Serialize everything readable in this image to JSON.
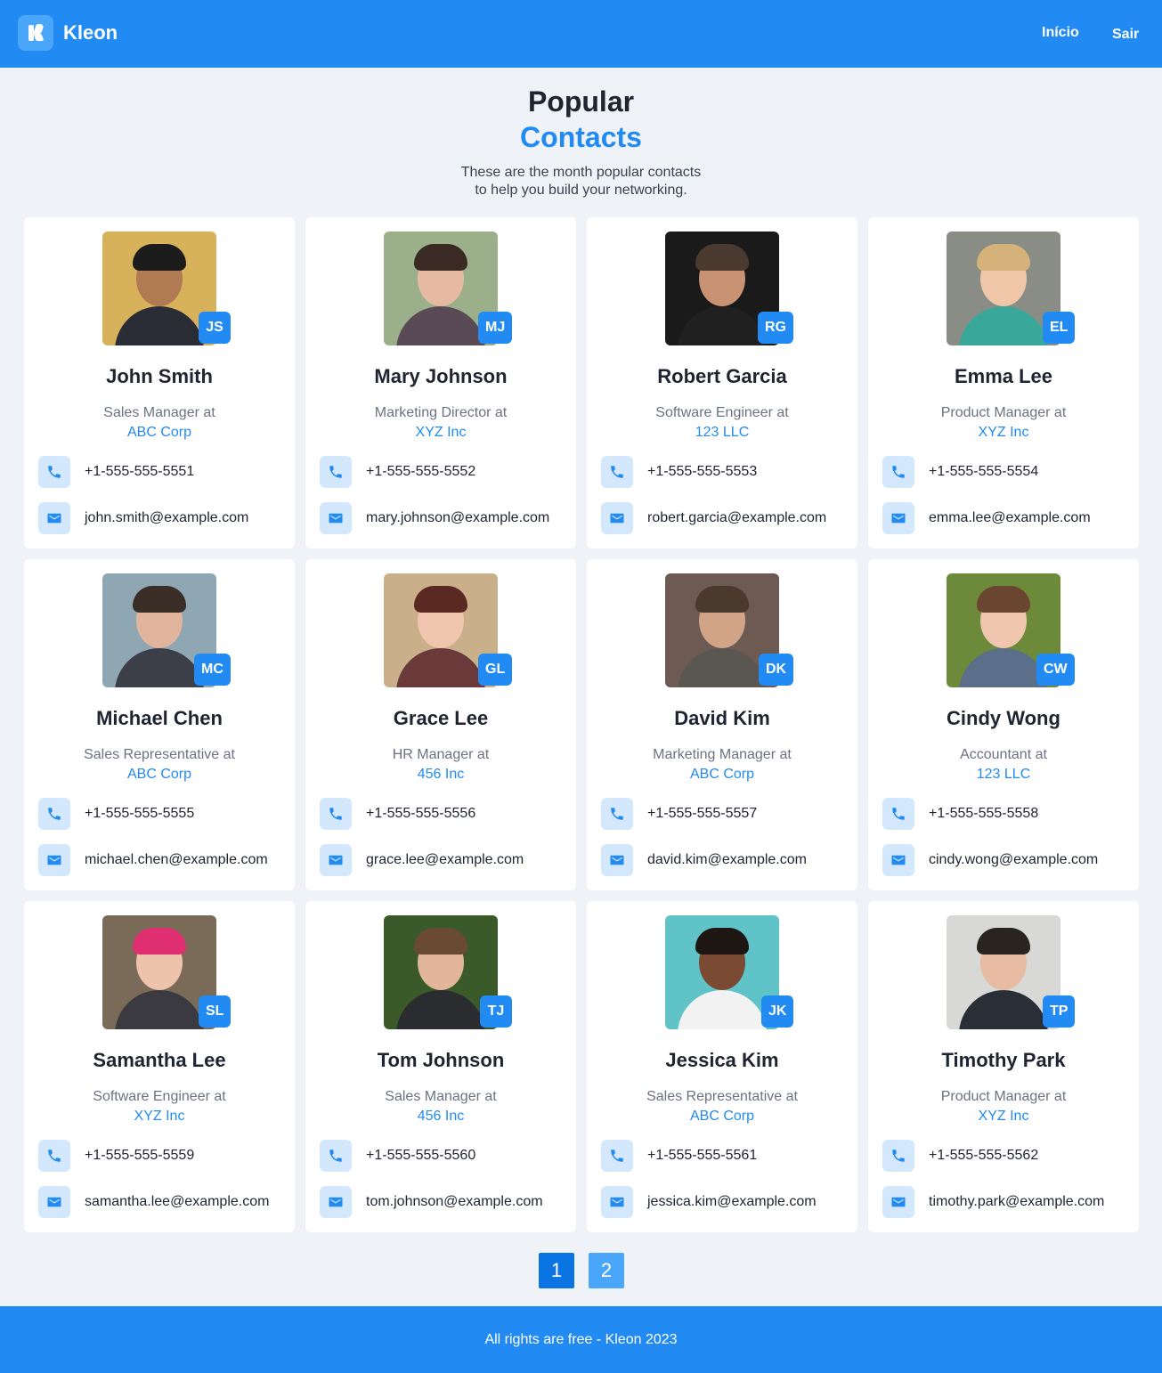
{
  "header": {
    "logo_text": "Kleon",
    "nav": [
      "Início",
      "Sair"
    ]
  },
  "hero": {
    "title_line1": "Popular",
    "title_line2": "Contacts",
    "subtitle_line1": "These are the month popular contacts",
    "subtitle_line2": "to help you build your networking."
  },
  "contacts": [
    {
      "initials": "JS",
      "name": "John Smith",
      "role": "Sales Manager at",
      "company": "ABC Corp",
      "phone": "+1-555-555-5551",
      "email": "john.smith@example.com",
      "photo_bg": "#d8b25a",
      "skin": "#b07a52",
      "hair": "#1c1c1c",
      "shirt": "#2a2c36"
    },
    {
      "initials": "MJ",
      "name": "Mary Johnson",
      "role": "Marketing Director at",
      "company": "XYZ Inc",
      "phone": "+1-555-555-5552",
      "email": "mary.johnson@example.com",
      "photo_bg": "#9bb08a",
      "skin": "#e6b9a2",
      "hair": "#3a2a24",
      "shirt": "#5a4a55"
    },
    {
      "initials": "RG",
      "name": "Robert Garcia",
      "role": "Software Engineer at",
      "company": "123 LLC",
      "phone": "+1-555-555-5553",
      "email": "robert.garcia@example.com",
      "photo_bg": "#1a1a1a",
      "skin": "#c99272",
      "hair": "#4a3a30",
      "shirt": "#202020"
    },
    {
      "initials": "EL",
      "name": "Emma Lee",
      "role": "Product Manager at",
      "company": "XYZ Inc",
      "phone": "+1-555-555-5554",
      "email": "emma.lee@example.com",
      "photo_bg": "#8a8d86",
      "skin": "#efc7a8",
      "hair": "#d5b27a",
      "shirt": "#3aa79b"
    },
    {
      "initials": "MC",
      "name": "Michael Chen",
      "role": "Sales Representative at",
      "company": "ABC Corp",
      "phone": "+1-555-555-5555",
      "email": "michael.chen@example.com",
      "photo_bg": "#8fa7b3",
      "skin": "#e1b59d",
      "hair": "#3a2e26",
      "shirt": "#3c3f48"
    },
    {
      "initials": "GL",
      "name": "Grace Lee",
      "role": "HR Manager at",
      "company": "456 Inc",
      "phone": "+1-555-555-5556",
      "email": "grace.lee@example.com",
      "photo_bg": "#c9b08a",
      "skin": "#f0c5ad",
      "hair": "#5a2a22",
      "shirt": "#6a3a3a"
    },
    {
      "initials": "DK",
      "name": "David Kim",
      "role": "Marketing Manager at",
      "company": "ABC Corp",
      "phone": "+1-555-555-5557",
      "email": "david.kim@example.com",
      "photo_bg": "#6d5a52",
      "skin": "#d1a488",
      "hair": "#4a3a2e",
      "shirt": "#5a5650"
    },
    {
      "initials": "CW",
      "name": "Cindy Wong",
      "role": "Accountant at",
      "company": "123 LLC",
      "phone": "+1-555-555-5558",
      "email": "cindy.wong@example.com",
      "photo_bg": "#6c8a3a",
      "skin": "#f0c7ae",
      "hair": "#6a4630",
      "shirt": "#5b6e8a"
    },
    {
      "initials": "SL",
      "name": "Samantha Lee",
      "role": "Software Engineer at",
      "company": "XYZ Inc",
      "phone": "+1-555-555-5559",
      "email": "samantha.lee@example.com",
      "photo_bg": "#7a6a58",
      "skin": "#eec3ac",
      "hair": "#e02f70",
      "shirt": "#3a3a40"
    },
    {
      "initials": "TJ",
      "name": "Tom Johnson",
      "role": "Sales Manager at",
      "company": "456 Inc",
      "phone": "+1-555-555-5560",
      "email": "tom.johnson@example.com",
      "photo_bg": "#3a5a2a",
      "skin": "#e2b69a",
      "hair": "#6a4a30",
      "shirt": "#2a2c30"
    },
    {
      "initials": "JK",
      "name": "Jessica Kim",
      "role": "Sales Representative at",
      "company": "ABC Corp",
      "phone": "+1-555-555-5561",
      "email": "jessica.kim@example.com",
      "photo_bg": "#5fc3c8",
      "skin": "#7a4a32",
      "hair": "#1e1612",
      "shirt": "#f2f2f2"
    },
    {
      "initials": "TP",
      "name": "Timothy Park",
      "role": "Product Manager at",
      "company": "XYZ Inc",
      "phone": "+1-555-555-5562",
      "email": "timothy.park@example.com",
      "photo_bg": "#d8d8d6",
      "skin": "#e8bca2",
      "hair": "#2a2420",
      "shirt": "#2a2e36"
    }
  ],
  "pagination": {
    "pages": [
      "1",
      "2"
    ],
    "current": "1"
  },
  "footer": {
    "text": "All rights are free - Kleon 2023"
  },
  "colors": {
    "primary": "#228bf3",
    "background": "#eff2f7",
    "icon_bg": "#d4e8fd"
  },
  "icons": {
    "phone": "phone-icon",
    "email": "mail-icon"
  }
}
